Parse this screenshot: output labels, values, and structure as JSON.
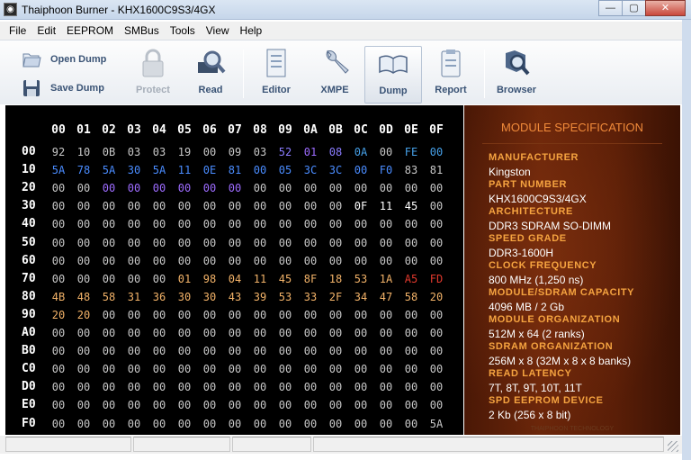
{
  "window": {
    "title": "Thaiphoon Burner - KHX1600C9S3/4GX",
    "icon": "thaiphoon-icon",
    "minimize": "—",
    "maximize": "▢",
    "close": "✕"
  },
  "menu": [
    "File",
    "Edit",
    "EEPROM",
    "SMBus",
    "Tools",
    "View",
    "Help"
  ],
  "toolbar": {
    "open_dump": "Open Dump",
    "save_dump": "Save Dump",
    "protect": "Protect",
    "read": "Read",
    "editor": "Editor",
    "xmpe": "XMPE",
    "dump": "Dump",
    "report": "Report",
    "browser": "Browser",
    "active": "Dump",
    "disabled": [
      "Protect"
    ]
  },
  "dump": {
    "col_headers": [
      "00",
      "01",
      "02",
      "03",
      "04",
      "05",
      "06",
      "07",
      "08",
      "09",
      "0A",
      "0B",
      "0C",
      "0D",
      "0E",
      "0F"
    ],
    "row_labels": [
      "00",
      "10",
      "20",
      "30",
      "40",
      "50",
      "60",
      "70",
      "80",
      "90",
      "A0",
      "B0",
      "C0",
      "D0",
      "E0",
      "F0"
    ],
    "colors": {
      "default": "#c8c8c8",
      "purple": "#8a7cff",
      "blue": "#4a8cff",
      "cyan": "#46a0e8",
      "orange": "#f2b268",
      "red": "#e0382c",
      "white": "#ffffff",
      "violet": "#9d6cff"
    },
    "rows": [
      [
        "92",
        "10",
        "0B",
        "03",
        "03",
        "19",
        "00",
        "09",
        "03",
        "52",
        "01",
        "08",
        "0A",
        "00",
        "FE",
        "00"
      ],
      [
        "5A",
        "78",
        "5A",
        "30",
        "5A",
        "11",
        "0E",
        "81",
        "00",
        "05",
        "3C",
        "3C",
        "00",
        "F0",
        "83",
        "81"
      ],
      [
        "00",
        "00",
        "00",
        "00",
        "00",
        "00",
        "00",
        "00",
        "00",
        "00",
        "00",
        "00",
        "00",
        "00",
        "00",
        "00"
      ],
      [
        "00",
        "00",
        "00",
        "00",
        "00",
        "00",
        "00",
        "00",
        "00",
        "00",
        "00",
        "00",
        "0F",
        "11",
        "45",
        "00"
      ],
      [
        "00",
        "00",
        "00",
        "00",
        "00",
        "00",
        "00",
        "00",
        "00",
        "00",
        "00",
        "00",
        "00",
        "00",
        "00",
        "00"
      ],
      [
        "00",
        "00",
        "00",
        "00",
        "00",
        "00",
        "00",
        "00",
        "00",
        "00",
        "00",
        "00",
        "00",
        "00",
        "00",
        "00"
      ],
      [
        "00",
        "00",
        "00",
        "00",
        "00",
        "00",
        "00",
        "00",
        "00",
        "00",
        "00",
        "00",
        "00",
        "00",
        "00",
        "00"
      ],
      [
        "00",
        "00",
        "00",
        "00",
        "00",
        "01",
        "98",
        "04",
        "11",
        "45",
        "8F",
        "18",
        "53",
        "1A",
        "A5",
        "FD"
      ],
      [
        "4B",
        "48",
        "58",
        "31",
        "36",
        "30",
        "30",
        "43",
        "39",
        "53",
        "33",
        "2F",
        "34",
        "47",
        "58",
        "20"
      ],
      [
        "20",
        "20",
        "00",
        "00",
        "00",
        "00",
        "00",
        "00",
        "00",
        "00",
        "00",
        "00",
        "00",
        "00",
        "00",
        "00"
      ],
      [
        "00",
        "00",
        "00",
        "00",
        "00",
        "00",
        "00",
        "00",
        "00",
        "00",
        "00",
        "00",
        "00",
        "00",
        "00",
        "00"
      ],
      [
        "00",
        "00",
        "00",
        "00",
        "00",
        "00",
        "00",
        "00",
        "00",
        "00",
        "00",
        "00",
        "00",
        "00",
        "00",
        "00"
      ],
      [
        "00",
        "00",
        "00",
        "00",
        "00",
        "00",
        "00",
        "00",
        "00",
        "00",
        "00",
        "00",
        "00",
        "00",
        "00",
        "00"
      ],
      [
        "00",
        "00",
        "00",
        "00",
        "00",
        "00",
        "00",
        "00",
        "00",
        "00",
        "00",
        "00",
        "00",
        "00",
        "00",
        "00"
      ],
      [
        "00",
        "00",
        "00",
        "00",
        "00",
        "00",
        "00",
        "00",
        "00",
        "00",
        "00",
        "00",
        "00",
        "00",
        "00",
        "00"
      ],
      [
        "00",
        "00",
        "00",
        "00",
        "00",
        "00",
        "00",
        "00",
        "00",
        "00",
        "00",
        "00",
        "00",
        "00",
        "00",
        "5A"
      ]
    ],
    "color_map": [
      [
        "default",
        "default",
        "default",
        "default",
        "default",
        "default",
        "default",
        "default",
        "default",
        "purple",
        "violet",
        "purple",
        "cyan",
        "default",
        "cyan",
        "cyan"
      ],
      [
        "blue",
        "blue",
        "blue",
        "blue",
        "blue",
        "blue",
        "blue",
        "blue",
        "blue",
        "blue",
        "blue",
        "blue",
        "blue",
        "blue",
        "default",
        "default"
      ],
      [
        "default",
        "default",
        "violet",
        "violet",
        "violet",
        "violet",
        "violet",
        "violet",
        "default",
        "default",
        "default",
        "default",
        "default",
        "default",
        "default",
        "default"
      ],
      [
        "default",
        "default",
        "default",
        "default",
        "default",
        "default",
        "default",
        "default",
        "default",
        "default",
        "default",
        "default",
        "white",
        "white",
        "white",
        "default"
      ],
      [],
      [],
      [],
      [
        "default",
        "default",
        "default",
        "default",
        "default",
        "orange",
        "orange",
        "orange",
        "orange",
        "orange",
        "orange",
        "orange",
        "orange",
        "orange",
        "red",
        "red"
      ],
      [
        "orange",
        "orange",
        "orange",
        "orange",
        "orange",
        "orange",
        "orange",
        "orange",
        "orange",
        "orange",
        "orange",
        "orange",
        "orange",
        "orange",
        "orange",
        "orange"
      ],
      [
        "orange",
        "orange",
        "default",
        "default",
        "default",
        "default",
        "default",
        "default",
        "default",
        "default",
        "default",
        "default",
        "default",
        "default",
        "default",
        "default"
      ],
      [],
      [],
      [],
      [],
      [],
      [
        "default",
        "default",
        "default",
        "default",
        "default",
        "default",
        "default",
        "default",
        "default",
        "default",
        "default",
        "default",
        "default",
        "default",
        "default",
        "default"
      ]
    ]
  },
  "spec": {
    "title": "MODULE SPECIFICATION",
    "items": [
      {
        "key": "MANUFACTURER",
        "value": "Kingston"
      },
      {
        "key": "PART NUMBER",
        "value": "KHX1600C9S3/4GX"
      },
      {
        "key": "ARCHITECTURE",
        "value": "DDR3 SDRAM SO-DIMM"
      },
      {
        "key": "SPEED GRADE",
        "value": "DDR3-1600H"
      },
      {
        "key": "CLOCK FREQUENCY",
        "value": "800 MHz (1,250 ns)"
      },
      {
        "key": "MODULE/SDRAM CAPACITY",
        "value": "4096 MB / 2 Gb"
      },
      {
        "key": "MODULE ORGANIZATION",
        "value": "512M x 64 (2 ranks)"
      },
      {
        "key": "SDRAM ORGANIZATION",
        "value": "256M x 8 (32M x 8 x 8 banks)"
      },
      {
        "key": "READ LATENCY",
        "value": "7T, 8T, 9T, 10T, 11T"
      },
      {
        "key": "SPD EEPROM DEVICE",
        "value": "2 Kb (256 x 8 bit)"
      }
    ],
    "footer": "THAIPHOON TECHNOLOGY"
  },
  "status": [
    "",
    "",
    "",
    ""
  ]
}
